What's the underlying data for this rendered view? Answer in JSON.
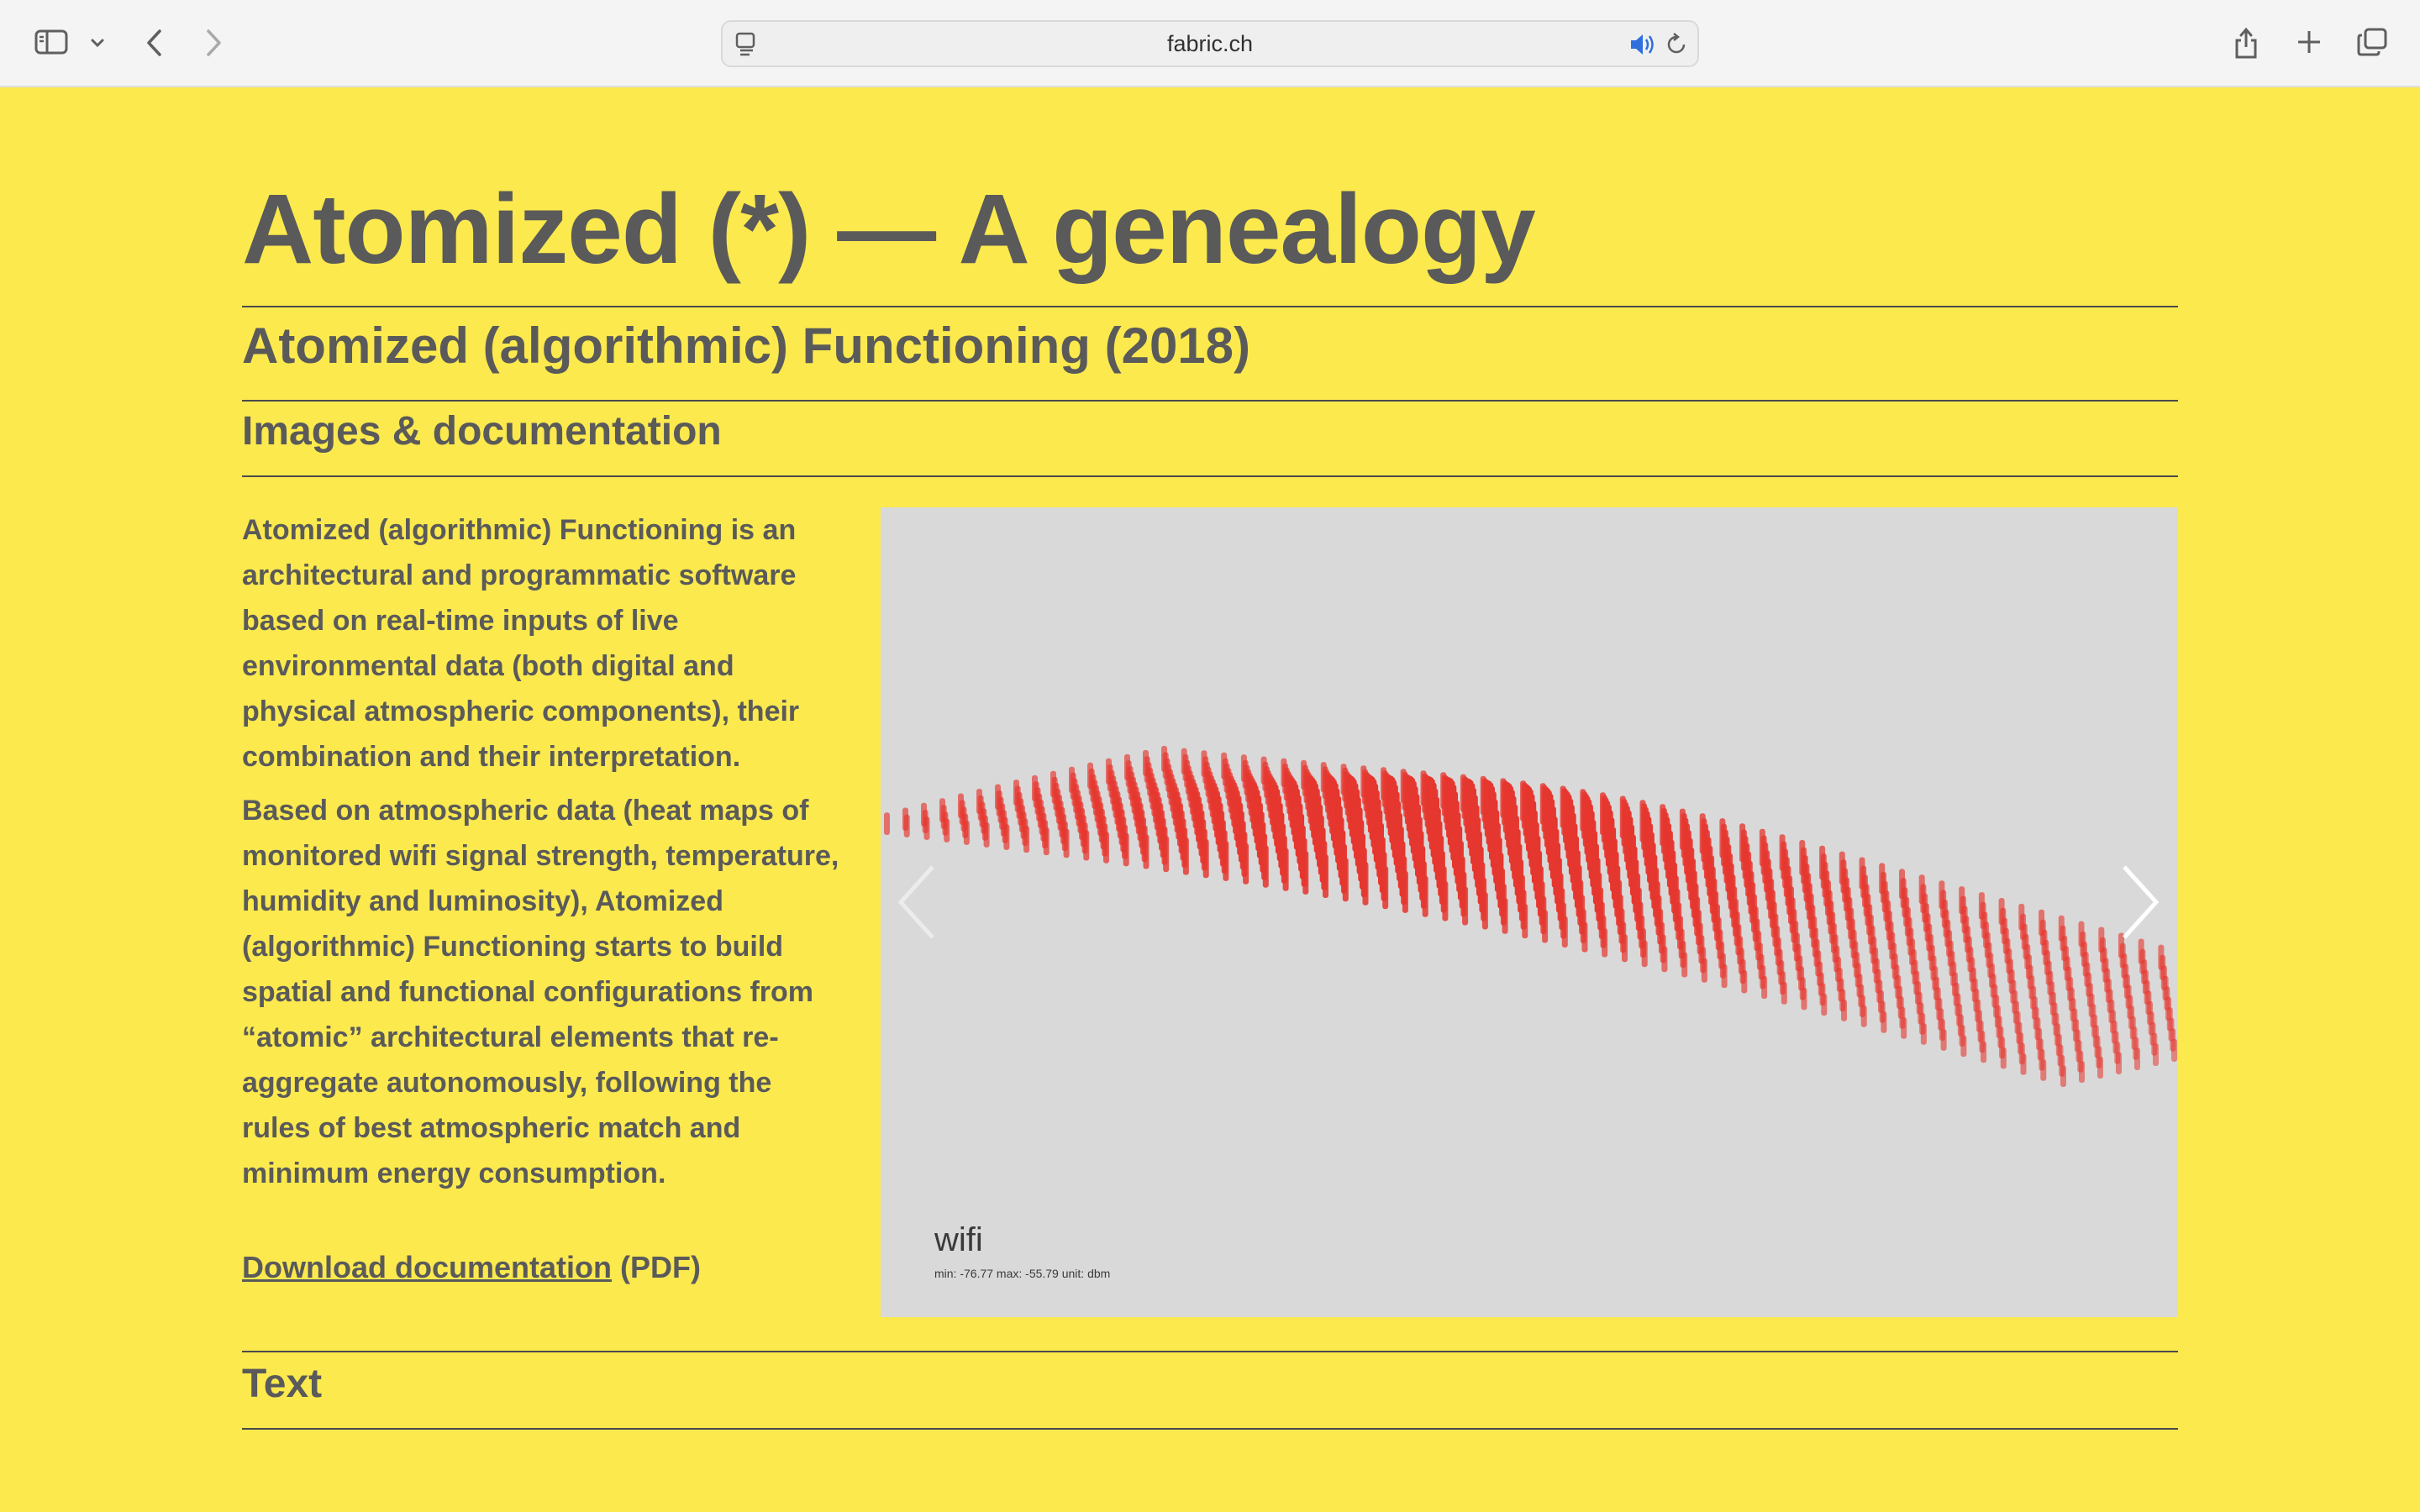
{
  "browser": {
    "url": "fabric.ch",
    "icons": {
      "sidebar": "sidebar-icon",
      "sidebar_menu": "chevron-down-icon",
      "back": "back-icon",
      "forward": "forward-icon",
      "tab": "page-icon",
      "audio": "speaker-icon",
      "reload": "reload-icon",
      "share": "share-icon",
      "new_tab": "plus-icon",
      "tabs": "tabs-overview-icon"
    },
    "audio_color": "#2f6fde"
  },
  "page": {
    "title": "Atomized (*) — A genealogy",
    "project_title": "Atomized (algorithmic) Functioning (2018)",
    "section_title": "Images & documentation",
    "paragraphs": [
      "Atomized (algorithmic) Functioning is an architectural and programmatic software based on real-time inputs of live environmental data (both digital and physical atmospheric components), their combination and their interpretation.",
      "Based on atmospheric data (heat maps of monitored wifi signal strength, temperature, humidity and luminosity), Atomized (algorithmic) Functioning starts to build spatial and functional configurations from “atomic” architectural elements that re-aggregate autonomously, following the rules of best atmospheric match and minimum energy consumption."
    ],
    "download_link": "Download documentation",
    "download_suffix": " (PDF)",
    "text_section": "Text"
  },
  "gallery": {
    "caption": "wifi",
    "subcaption": "min: -76.77 max: -55.79 unit: dbm",
    "prev_icon": "chevron-left-icon",
    "next_icon": "chevron-right-icon",
    "bar_color": "#e5372f",
    "background": "#d9d9d9"
  },
  "colors": {
    "page_background": "#fbe94e",
    "text": "#5a5a5a",
    "rule": "#4a4a4a"
  }
}
